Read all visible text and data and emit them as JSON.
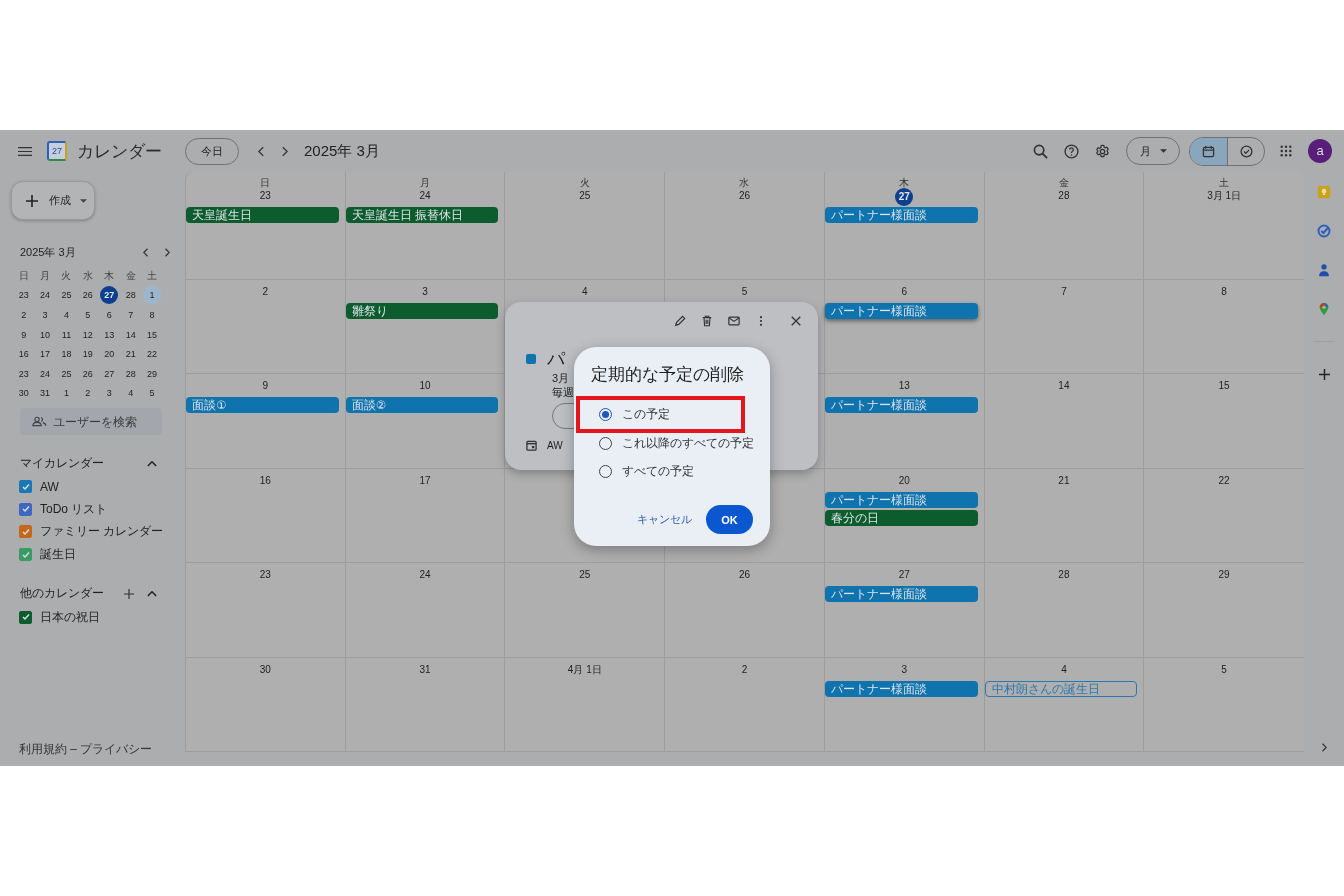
{
  "header": {
    "app_name": "カレンダー",
    "logo_day": "27",
    "today_button": "今日",
    "period": "2025年 3月",
    "view_button": "月",
    "avatar": "a",
    "view_toggle": [
      {
        "kind": "calendar",
        "selected": true
      },
      {
        "kind": "tasks",
        "selected": false
      }
    ]
  },
  "sidebar": {
    "create_button": "作成",
    "mini_calendar": {
      "title": "2025年 3月",
      "weekdays": [
        "日",
        "月",
        "火",
        "水",
        "木",
        "金",
        "土"
      ],
      "days": [
        {
          "label": "23",
          "today": false,
          "selected": false
        },
        {
          "label": "24",
          "today": false,
          "selected": false
        },
        {
          "label": "25",
          "today": false,
          "selected": false
        },
        {
          "label": "26",
          "today": false,
          "selected": false
        },
        {
          "label": "27",
          "today": true,
          "selected": false
        },
        {
          "label": "28",
          "today": false,
          "selected": false
        },
        {
          "label": "1",
          "today": false,
          "selected": true
        },
        {
          "label": "2",
          "today": false,
          "selected": false
        },
        {
          "label": "3",
          "today": false,
          "selected": false
        },
        {
          "label": "4",
          "today": false,
          "selected": false
        },
        {
          "label": "5",
          "today": false,
          "selected": false
        },
        {
          "label": "6",
          "today": false,
          "selected": false
        },
        {
          "label": "7",
          "today": false,
          "selected": false
        },
        {
          "label": "8",
          "today": false,
          "selected": false
        },
        {
          "label": "9",
          "today": false,
          "selected": false
        },
        {
          "label": "10",
          "today": false,
          "selected": false
        },
        {
          "label": "11",
          "today": false,
          "selected": false
        },
        {
          "label": "12",
          "today": false,
          "selected": false
        },
        {
          "label": "13",
          "today": false,
          "selected": false
        },
        {
          "label": "14",
          "today": false,
          "selected": false
        },
        {
          "label": "15",
          "today": false,
          "selected": false
        },
        {
          "label": "16",
          "today": false,
          "selected": false
        },
        {
          "label": "17",
          "today": false,
          "selected": false
        },
        {
          "label": "18",
          "today": false,
          "selected": false
        },
        {
          "label": "19",
          "today": false,
          "selected": false
        },
        {
          "label": "20",
          "today": false,
          "selected": false
        },
        {
          "label": "21",
          "today": false,
          "selected": false
        },
        {
          "label": "22",
          "today": false,
          "selected": false
        },
        {
          "label": "23",
          "today": false,
          "selected": false
        },
        {
          "label": "24",
          "today": false,
          "selected": false
        },
        {
          "label": "25",
          "today": false,
          "selected": false
        },
        {
          "label": "26",
          "today": false,
          "selected": false
        },
        {
          "label": "27",
          "today": false,
          "selected": false
        },
        {
          "label": "28",
          "today": false,
          "selected": false
        },
        {
          "label": "29",
          "today": false,
          "selected": false
        },
        {
          "label": "30",
          "today": false,
          "selected": false
        },
        {
          "label": "31",
          "today": false,
          "selected": false
        },
        {
          "label": "1",
          "today": false,
          "selected": false
        },
        {
          "label": "2",
          "today": false,
          "selected": false
        },
        {
          "label": "3",
          "today": false,
          "selected": false
        },
        {
          "label": "4",
          "today": false,
          "selected": false
        },
        {
          "label": "5",
          "today": false,
          "selected": false
        }
      ]
    },
    "people_search": {
      "placeholder": "ユーザーを検索"
    },
    "my_calendars": {
      "title": "マイカレンダー",
      "expanded": true,
      "items": [
        {
          "label": "AW",
          "checked": true,
          "color": "#1a78b4"
        },
        {
          "label": "ToDo リスト",
          "checked": true,
          "color": "#3f66c0"
        },
        {
          "label": "ファミリー カレンダー",
          "checked": true,
          "color": "#c4691c"
        },
        {
          "label": "誕生日",
          "checked": true,
          "color": "#3a9a63"
        }
      ]
    },
    "other_calendars": {
      "title": "他のカレンダー",
      "expanded": true,
      "items": [
        {
          "label": "日本の祝日",
          "checked": true,
          "color": "#0c5c2e"
        }
      ]
    },
    "footer": "利用規約 – プライバシー"
  },
  "month": {
    "weekdays": [
      "日",
      "月",
      "火",
      "水",
      "木",
      "金",
      "土"
    ],
    "cells": [
      {
        "label": "23",
        "events": [
          {
            "title": "天皇誕生日",
            "kind": "filled",
            "color": "#0c5c2e",
            "selected": false
          }
        ]
      },
      {
        "label": "24",
        "events": [
          {
            "title": "天皇誕生日 振替休日",
            "kind": "filled",
            "color": "#0c5c2e",
            "selected": false
          }
        ]
      },
      {
        "label": "25"
      },
      {
        "label": "26"
      },
      {
        "label": "27",
        "today": true,
        "events": [
          {
            "title": "パートナー様面談",
            "kind": "filled",
            "color": "#0f73ae",
            "selected": false
          }
        ]
      },
      {
        "label": "28"
      },
      {
        "label": "3月 1日"
      },
      {
        "label": "2"
      },
      {
        "label": "3",
        "events": [
          {
            "title": "雛祭り",
            "kind": "filled",
            "color": "#0c5c2e",
            "selected": false
          }
        ]
      },
      {
        "label": "4"
      },
      {
        "label": "5"
      },
      {
        "label": "6",
        "events": [
          {
            "title": "パートナー様面談",
            "kind": "filled",
            "color": "#0f73ae",
            "selected": true
          }
        ]
      },
      {
        "label": "7"
      },
      {
        "label": "8"
      },
      {
        "label": "9",
        "events": [
          {
            "title": "面談①",
            "kind": "filled",
            "color": "#0f73ae",
            "selected": false
          }
        ]
      },
      {
        "label": "10",
        "events": [
          {
            "title": "面談②",
            "kind": "filled",
            "color": "#0f73ae",
            "selected": false
          }
        ]
      },
      {},
      {},
      {
        "label": "13",
        "events": [
          {
            "title": "パートナー様面談",
            "kind": "filled",
            "color": "#0f73ae",
            "selected": false
          }
        ]
      },
      {
        "label": "14"
      },
      {
        "label": "15"
      },
      {
        "label": "16"
      },
      {
        "label": "17"
      },
      {},
      {},
      {
        "label": "20",
        "events": [
          {
            "title": "パートナー様面談",
            "kind": "filled",
            "color": "#0f73ae",
            "selected": false
          },
          {
            "title": "春分の日",
            "kind": "filled",
            "color": "#0c5c2e",
            "selected": false
          }
        ]
      },
      {
        "label": "21"
      },
      {
        "label": "22"
      },
      {
        "label": "23"
      },
      {
        "label": "24"
      },
      {
        "label": "25"
      },
      {
        "label": "26"
      },
      {
        "label": "27",
        "events": [
          {
            "title": "パートナー様面談",
            "kind": "filled",
            "color": "#0f73ae",
            "selected": false
          }
        ]
      },
      {
        "label": "28"
      },
      {
        "label": "29"
      },
      {
        "label": "30"
      },
      {
        "label": "31"
      },
      {
        "label": "4月 1日"
      },
      {
        "label": "2"
      },
      {
        "label": "3",
        "events": [
          {
            "title": "パートナー様面談",
            "kind": "filled",
            "color": "#0f73ae",
            "selected": false
          }
        ]
      },
      {
        "label": "4",
        "events": [
          {
            "title": "中村朗さんの誕生日",
            "kind": "outlined",
            "color": "#2b78ad",
            "selected": false
          }
        ]
      },
      {
        "label": "5"
      }
    ]
  },
  "event_popup": {
    "title": "パ",
    "date": "3月",
    "recurrence": "毎週",
    "calendar": "AW",
    "color": "#0f73ae"
  },
  "dialog": {
    "title": "定期的な予定の削除",
    "options": [
      {
        "label": "この予定",
        "selected": true,
        "highlighted": true
      },
      {
        "label": "これ以降のすべての予定",
        "selected": false,
        "highlighted": false
      },
      {
        "label": "すべての予定",
        "selected": false,
        "highlighted": false
      }
    ],
    "cancel": "キャンセル",
    "ok": "OK"
  }
}
